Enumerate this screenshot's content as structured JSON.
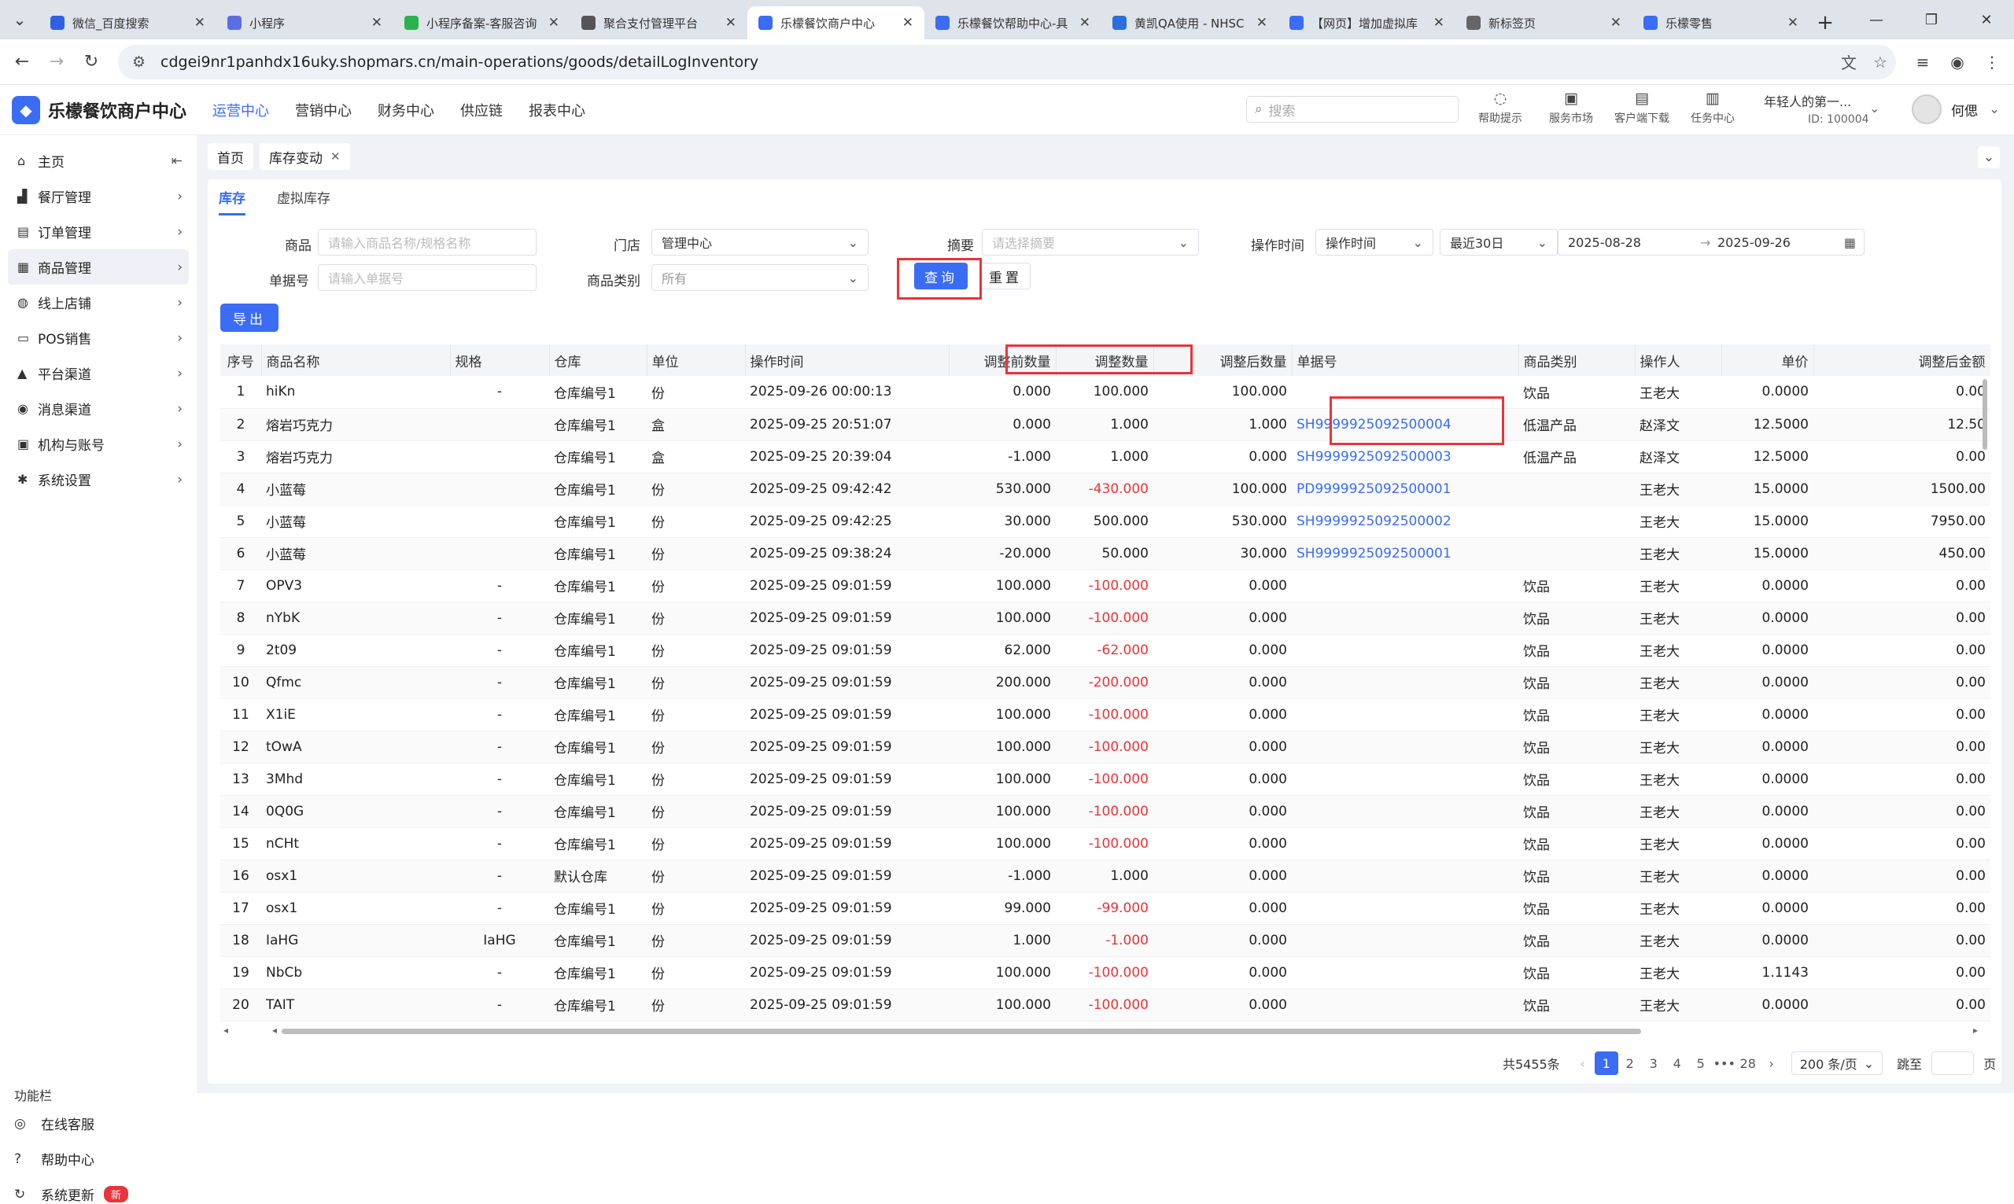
{
  "browser": {
    "tabs": [
      {
        "title": "微信_百度搜索",
        "color": "#3060e0"
      },
      {
        "title": "小程序",
        "color": "#5b6ee0"
      },
      {
        "title": "小程序备案-客服咨询",
        "color": "#2bb24c"
      },
      {
        "title": "聚合支付管理平台",
        "color": "#555555"
      },
      {
        "title": "乐檬餐饮商户中心",
        "color": "#3a6cf4",
        "active": true
      },
      {
        "title": "乐檬餐饮帮助中心-具",
        "color": "#3a6cf4"
      },
      {
        "title": "黄凯QA使用 - NHSC",
        "color": "#2a6fdc"
      },
      {
        "title": "【网页】增加虚拟库",
        "color": "#3a6cf4"
      },
      {
        "title": "新标签页",
        "color": "#666666"
      },
      {
        "title": "乐檬零售",
        "color": "#3a6cf4"
      }
    ],
    "url": "cdgei9nr1panhdx16uky.shopmars.cn/main-operations/goods/detailLogInventory"
  },
  "app": {
    "brand": "乐檬餐饮商户中心",
    "topnav": [
      "运营中心",
      "营销中心",
      "财务中心",
      "供应链",
      "报表中心"
    ],
    "search_placeholder": "搜索",
    "header_icons": [
      "帮助提示",
      "服务市场",
      "客户端下载",
      "任务中心"
    ],
    "org_name": "年轻人的第一...",
    "org_id": "ID: 100004",
    "user_name": "何偲"
  },
  "sidebar": {
    "items": [
      {
        "label": "主页",
        "icon": "home-icon"
      },
      {
        "label": "餐厅管理",
        "icon": "shop-icon"
      },
      {
        "label": "订单管理",
        "icon": "order-icon"
      },
      {
        "label": "商品管理",
        "icon": "goods-icon"
      },
      {
        "label": "线上店铺",
        "icon": "globe-icon"
      },
      {
        "label": "POS销售",
        "icon": "pos-icon"
      },
      {
        "label": "平台渠道",
        "icon": "platform-icon"
      },
      {
        "label": "消息渠道",
        "icon": "message-icon"
      },
      {
        "label": "机构与账号",
        "icon": "account-icon"
      },
      {
        "label": "系统设置",
        "icon": "gear-icon"
      }
    ],
    "func_title": "功能栏",
    "func_items": [
      "在线客服",
      "帮助中心",
      "系统更新"
    ],
    "new_badge": "新"
  },
  "crumbs": {
    "home": "首页",
    "current": "库存变动"
  },
  "subtabs": [
    "库存",
    "虚拟库存"
  ],
  "filters": {
    "goods_label": "商品",
    "goods_placeholder": "请输入商品名称/规格名称",
    "store_label": "门店",
    "store_value": "管理中心",
    "summary_label": "摘要",
    "summary_placeholder": "请选择摘要",
    "optime_label": "操作时间",
    "optime_select": "操作时间",
    "range_select": "最近30日",
    "date_from": "2025-08-28",
    "date_sep": "→",
    "date_to": "2025-09-26",
    "docno_label": "单据号",
    "docno_placeholder": "请输入单据号",
    "category_label": "商品类别",
    "category_value": "所有",
    "query": "查询",
    "reset": "重置",
    "export": "导出"
  },
  "table": {
    "headers": [
      "序号",
      "商品名称",
      "规格",
      "仓库",
      "单位",
      "操作时间",
      "调整前数量",
      "调整数量",
      "调整后数量",
      "单据号",
      "商品类别",
      "操作人",
      "单价",
      "调整后金额"
    ],
    "rows": [
      [
        "1",
        "hiKn",
        "-",
        "仓库编号1",
        "份",
        "2025-09-26 00:00:13",
        "0.000",
        "100.000",
        "100.000",
        "",
        "饮品",
        "王老大",
        "0.0000",
        "0.00"
      ],
      [
        "2",
        "熔岩巧克力",
        "",
        "仓库编号1",
        "盒",
        "2025-09-25 20:51:07",
        "0.000",
        "1.000",
        "1.000",
        "SH9999925092500004",
        "低温产品",
        "赵泽文",
        "12.5000",
        "12.50"
      ],
      [
        "3",
        "熔岩巧克力",
        "",
        "仓库编号1",
        "盒",
        "2025-09-25 20:39:04",
        "-1.000",
        "1.000",
        "0.000",
        "SH9999925092500003",
        "低温产品",
        "赵泽文",
        "12.5000",
        "0.00"
      ],
      [
        "4",
        "小蓝莓",
        "",
        "仓库编号1",
        "份",
        "2025-09-25 09:42:42",
        "530.000",
        "-430.000",
        "100.000",
        "PD9999925092500001",
        "",
        "王老大",
        "15.0000",
        "1500.00"
      ],
      [
        "5",
        "小蓝莓",
        "",
        "仓库编号1",
        "份",
        "2025-09-25 09:42:25",
        "30.000",
        "500.000",
        "530.000",
        "SH9999925092500002",
        "",
        "王老大",
        "15.0000",
        "7950.00"
      ],
      [
        "6",
        "小蓝莓",
        "",
        "仓库编号1",
        "份",
        "2025-09-25 09:38:24",
        "-20.000",
        "50.000",
        "30.000",
        "SH9999925092500001",
        "",
        "王老大",
        "15.0000",
        "450.00"
      ],
      [
        "7",
        "OPV3",
        "-",
        "仓库编号1",
        "份",
        "2025-09-25 09:01:59",
        "100.000",
        "-100.000",
        "0.000",
        "",
        "饮品",
        "王老大",
        "0.0000",
        "0.00"
      ],
      [
        "8",
        "nYbK",
        "-",
        "仓库编号1",
        "份",
        "2025-09-25 09:01:59",
        "100.000",
        "-100.000",
        "0.000",
        "",
        "饮品",
        "王老大",
        "0.0000",
        "0.00"
      ],
      [
        "9",
        "2t09",
        "-",
        "仓库编号1",
        "份",
        "2025-09-25 09:01:59",
        "62.000",
        "-62.000",
        "0.000",
        "",
        "饮品",
        "王老大",
        "0.0000",
        "0.00"
      ],
      [
        "10",
        "Qfmc",
        "-",
        "仓库编号1",
        "份",
        "2025-09-25 09:01:59",
        "200.000",
        "-200.000",
        "0.000",
        "",
        "饮品",
        "王老大",
        "0.0000",
        "0.00"
      ],
      [
        "11",
        "X1iE",
        "-",
        "仓库编号1",
        "份",
        "2025-09-25 09:01:59",
        "100.000",
        "-100.000",
        "0.000",
        "",
        "饮品",
        "王老大",
        "0.0000",
        "0.00"
      ],
      [
        "12",
        "tOwA",
        "-",
        "仓库编号1",
        "份",
        "2025-09-25 09:01:59",
        "100.000",
        "-100.000",
        "0.000",
        "",
        "饮品",
        "王老大",
        "0.0000",
        "0.00"
      ],
      [
        "13",
        "3Mhd",
        "-",
        "仓库编号1",
        "份",
        "2025-09-25 09:01:59",
        "100.000",
        "-100.000",
        "0.000",
        "",
        "饮品",
        "王老大",
        "0.0000",
        "0.00"
      ],
      [
        "14",
        "0Q0G",
        "-",
        "仓库编号1",
        "份",
        "2025-09-25 09:01:59",
        "100.000",
        "-100.000",
        "0.000",
        "",
        "饮品",
        "王老大",
        "0.0000",
        "0.00"
      ],
      [
        "15",
        "nCHt",
        "-",
        "仓库编号1",
        "份",
        "2025-09-25 09:01:59",
        "100.000",
        "-100.000",
        "0.000",
        "",
        "饮品",
        "王老大",
        "0.0000",
        "0.00"
      ],
      [
        "16",
        "osx1",
        "-",
        "默认仓库",
        "份",
        "2025-09-25 09:01:59",
        "-1.000",
        "1.000",
        "0.000",
        "",
        "饮品",
        "王老大",
        "0.0000",
        "0.00"
      ],
      [
        "17",
        "osx1",
        "-",
        "仓库编号1",
        "份",
        "2025-09-25 09:01:59",
        "99.000",
        "-99.000",
        "0.000",
        "",
        "饮品",
        "王老大",
        "0.0000",
        "0.00"
      ],
      [
        "18",
        "IaHG",
        "IaHG",
        "仓库编号1",
        "份",
        "2025-09-25 09:01:59",
        "1.000",
        "-1.000",
        "0.000",
        "",
        "饮品",
        "王老大",
        "0.0000",
        "0.00"
      ],
      [
        "19",
        "NbCb",
        "-",
        "仓库编号1",
        "份",
        "2025-09-25 09:01:59",
        "100.000",
        "-100.000",
        "0.000",
        "",
        "饮品",
        "王老大",
        "1.1143",
        "0.00"
      ],
      [
        "20",
        "TAIT",
        "-",
        "仓库编号1",
        "份",
        "2025-09-25 09:01:59",
        "100.000",
        "-100.000",
        "0.000",
        "",
        "饮品",
        "王老大",
        "0.0000",
        "0.00"
      ]
    ]
  },
  "pagination": {
    "total": "共5455条",
    "pages": [
      "1",
      "2",
      "3",
      "4",
      "5",
      "•••",
      "28"
    ],
    "page_size": "200 条/页",
    "jump_label": "跳至",
    "page_suffix": "页"
  },
  "colors": {
    "accent": "#3a6cf4",
    "negative": "#e8343a",
    "highlight_box": "#e8343a"
  }
}
